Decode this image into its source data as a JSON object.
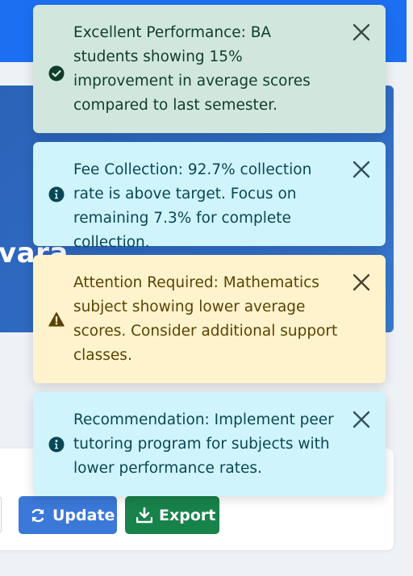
{
  "page": {
    "hero_title": "vara",
    "buttons": {
      "update_label": "Update",
      "export_label": "Export"
    }
  },
  "colors": {
    "success_bg": "#d1e7dd",
    "info_bg": "#cff4fc",
    "warning_bg": "#fff3cd",
    "primary": "#1d6ff2",
    "export_green": "#18824b"
  },
  "toasts": [
    {
      "type": "success",
      "icon": "check-circle-icon",
      "message": "Excellent Performance: BA students showing 15% improvement in average scores compared to last semester."
    },
    {
      "type": "info",
      "icon": "info-circle-icon",
      "message": "Fee Collection: 92.7% collection rate is above target. Focus on remaining 7.3% for complete collection."
    },
    {
      "type": "warning",
      "icon": "warning-triangle-icon",
      "message": "Attention Required: Mathematics subject showing lower average scores. Consider additional support classes."
    },
    {
      "type": "info",
      "icon": "info-circle-icon",
      "message": "Recommendation: Implement peer tutoring program for subjects with lower performance rates."
    }
  ]
}
